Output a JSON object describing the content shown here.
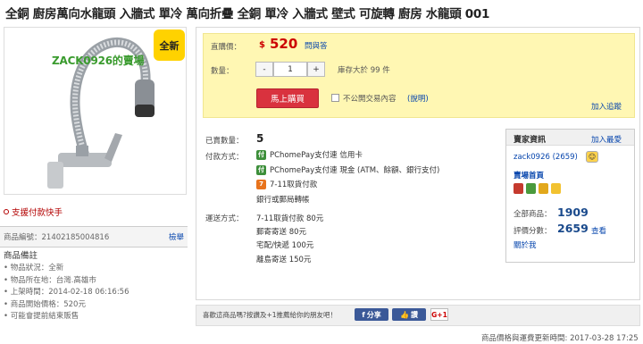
{
  "title": "全銅 廚房萬向水龍頭 入牆式 單冷 萬向折疊 全銅 單冷 入牆式 壁式 可旋轉 廚房 水龍頭 001",
  "image": {
    "badge": "全新",
    "watermark": "ZACK0926的賣場"
  },
  "support_link": "支援付款快手",
  "product_code": {
    "label": "商品編號：",
    "value": "21402185004816",
    "report": "檢舉"
  },
  "notes": {
    "heading": "商品備註",
    "items": [
      "物品狀況：全新",
      "物品所在地：台灣.高雄市",
      "上架時間：2014-02-18 06:16:56",
      "商品開始價格：520元",
      "可能會提前結束販售"
    ]
  },
  "price": {
    "label": "直購價：",
    "currency": "$",
    "value": "520",
    "ask": "問與答"
  },
  "quantity": {
    "label": "數量：",
    "minus": "-",
    "value": "1",
    "plus": "+",
    "stock": "庫存大於 99 件"
  },
  "buy_button": "馬上購買",
  "private_trade": {
    "label": "不公開交易內容",
    "explain": "(說明)"
  },
  "track_link": "加入追蹤",
  "sold": {
    "label": "已賣數量：",
    "value": "5"
  },
  "payment": {
    "label": "付款方式：",
    "methods": [
      "PChomePay支付連 信用卡",
      "PChomePay支付連 現金 (ATM、餘額、銀行支付)",
      "7-11取貨付款",
      "銀行或郵局轉帳"
    ]
  },
  "shipping": {
    "label": "運送方式：",
    "methods": [
      "7-11取貨付款 80元",
      "郵寄寄送 80元",
      "宅配/快遞 100元",
      "離島寄送 150元"
    ]
  },
  "seller": {
    "title": "賣家資訊",
    "add_fav": "加入最愛",
    "name": "zack0926",
    "score_paren": "(2659)",
    "store_home": "賣場首頁",
    "all_goods_label": "全部商品：",
    "all_goods_value": "1909",
    "rating_label": "評價分數：",
    "rating_value": "2659",
    "view": "查看",
    "about": "關於我"
  },
  "share": {
    "text": "喜歡這商品嗎?按讚及+1推薦給你的朋友吧！",
    "fb_share": "分享",
    "fb_like": "讚",
    "like_count": "0",
    "gplus": "G+1"
  },
  "update_note": "商品價格與運費更新時間: 2017-03-28 17:25",
  "colors": {
    "price_red": "#cc0000",
    "buy_red": "#d9323e",
    "yellow_bg": "#fff7b3",
    "link_blue": "#0645ad",
    "fb_blue": "#3b5998"
  }
}
